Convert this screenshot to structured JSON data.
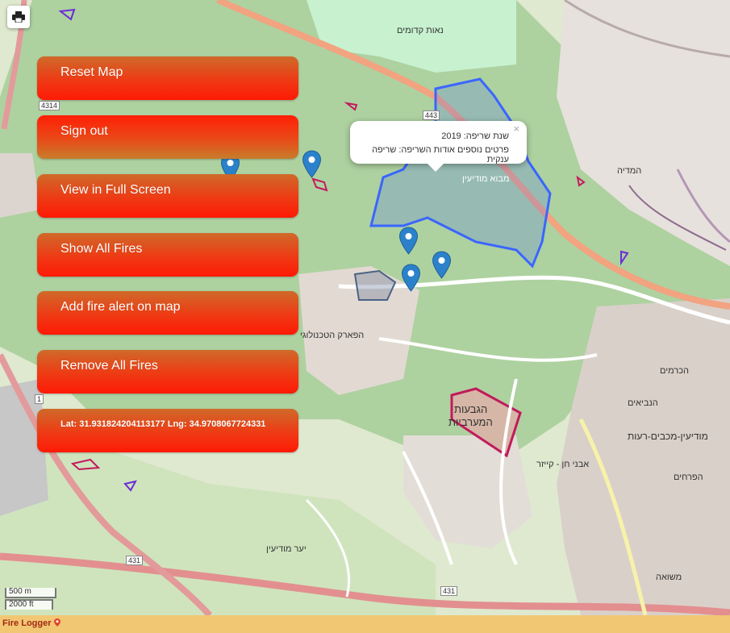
{
  "map": {
    "labels": [
      {
        "text": "נאות קדומים"
      },
      {
        "text": "מבוא מודיעין"
      },
      {
        "text": "הגבעות"
      },
      {
        "text": "המערביות"
      },
      {
        "text": "מודיעין-מכבים-רעות"
      },
      {
        "text": "הכרמים"
      },
      {
        "text": "הנביאים"
      },
      {
        "text": "הפרחים"
      },
      {
        "text": "משואה"
      },
      {
        "text": "אבני חן - קייזר"
      },
      {
        "text": "יער מודיעין"
      },
      {
        "text": "המדיה"
      },
      {
        "text": "הפארק הטכנולוגי"
      }
    ],
    "road_numbers": [
      "4314",
      "443",
      "431",
      "431",
      "1"
    ]
  },
  "controls": {
    "print_icon": "printer-icon"
  },
  "buttons": {
    "reset": "Reset Map",
    "signout": "Sign out",
    "fullscreen": "View in Full Screen",
    "showall": "Show All Fires",
    "addalert": "Add fire alert on map",
    "removeall": "Remove All Fires",
    "coords": "Lat: 31.931824204113177 Lng: 34.9708067724331"
  },
  "popup": {
    "close": "×",
    "year_line": "שנת שריפה: 2019",
    "details_line": "פרטים נוספים אודות השריפה: שריפה ענקית"
  },
  "scale": {
    "metric": "500 m",
    "imperial": "2000 ft"
  },
  "footer": {
    "brand": "Fire Logger",
    "brand_icon": "map-pin-icon"
  },
  "colors": {
    "button_red": "#ff1a06",
    "button_orange": "#cf6a2a",
    "footer": "#f2c774",
    "fire_area_blue": "#3a66ff",
    "marker_blue": "#2b82cb"
  }
}
